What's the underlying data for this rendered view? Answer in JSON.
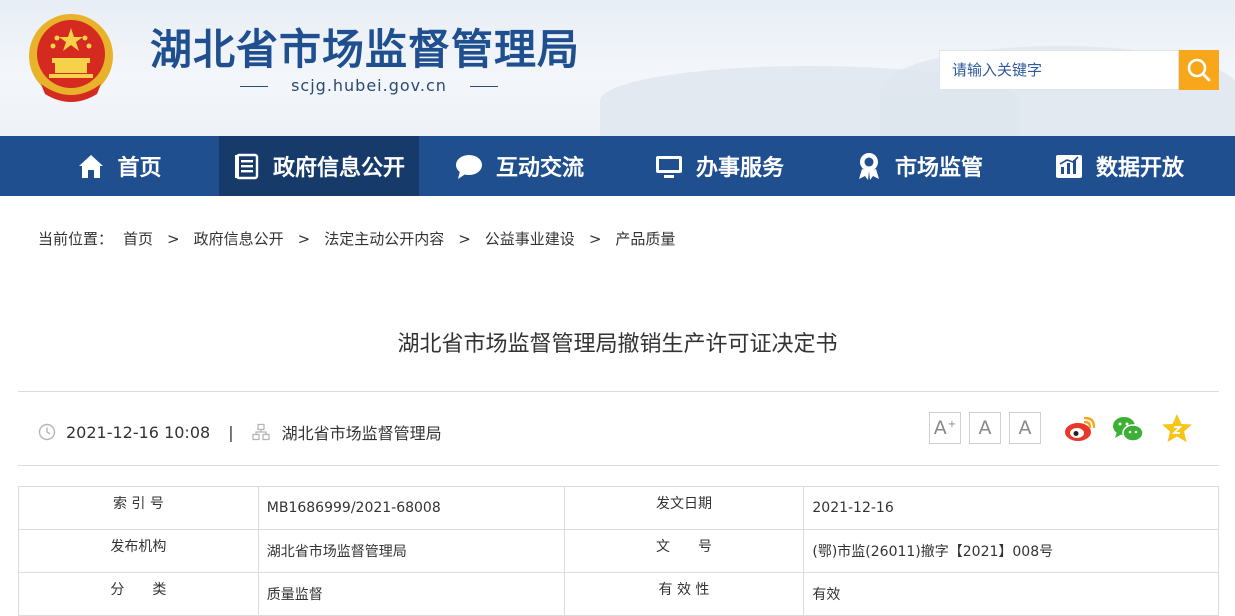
{
  "header": {
    "site_title": "湖北省市场监督管理局",
    "site_url": "scjg.hubei.gov.cn",
    "search_placeholder": "请输入关键字"
  },
  "nav": [
    {
      "label": "首页",
      "icon": "home-icon",
      "active": false
    },
    {
      "label": "政府信息公开",
      "icon": "document-list-icon",
      "active": true
    },
    {
      "label": "互动交流",
      "icon": "chat-bubble-icon",
      "active": false
    },
    {
      "label": "办事服务",
      "icon": "monitor-icon",
      "active": false
    },
    {
      "label": "市场监管",
      "icon": "award-badge-icon",
      "active": false
    },
    {
      "label": "数据开放",
      "icon": "bar-chart-icon",
      "active": false
    }
  ],
  "breadcrumb": {
    "prefix": "当前位置：",
    "separator": ">",
    "items": [
      "首页",
      "政府信息公开",
      "法定主动公开内容",
      "公益事业建设",
      "产品质量"
    ]
  },
  "article": {
    "title": "湖北省市场监督管理局撤销生产许可证决定书",
    "datetime": "2021-12-16 10:08",
    "meta_separator": "|",
    "source": "湖北省市场监督管理局"
  },
  "font_controls": {
    "large": "A",
    "large_sup": "+",
    "medium": "A",
    "small": "A"
  },
  "share_icons": [
    "weibo-icon",
    "wechat-icon",
    "favorite-star-icon"
  ],
  "info_table": {
    "rows": [
      [
        {
          "label": "索 引 号",
          "value": "MB1686999/2021-68008"
        },
        {
          "label": "发文日期",
          "value": "2021-12-16"
        }
      ],
      [
        {
          "label": "发布机构",
          "value": "湖北省市场监督管理局"
        },
        {
          "label": "文　　号",
          "value": "(鄂)市监(26011)撤字【2021】008号"
        }
      ],
      [
        {
          "label": "分　　类",
          "value": "质量监督"
        },
        {
          "label": "有 效 性",
          "value": "有效"
        }
      ]
    ]
  },
  "colors": {
    "nav_bg": "#1f4f8f",
    "nav_active": "#163a6a",
    "search_button": "#f8a71b",
    "title_blue": "#1f4f8f"
  }
}
